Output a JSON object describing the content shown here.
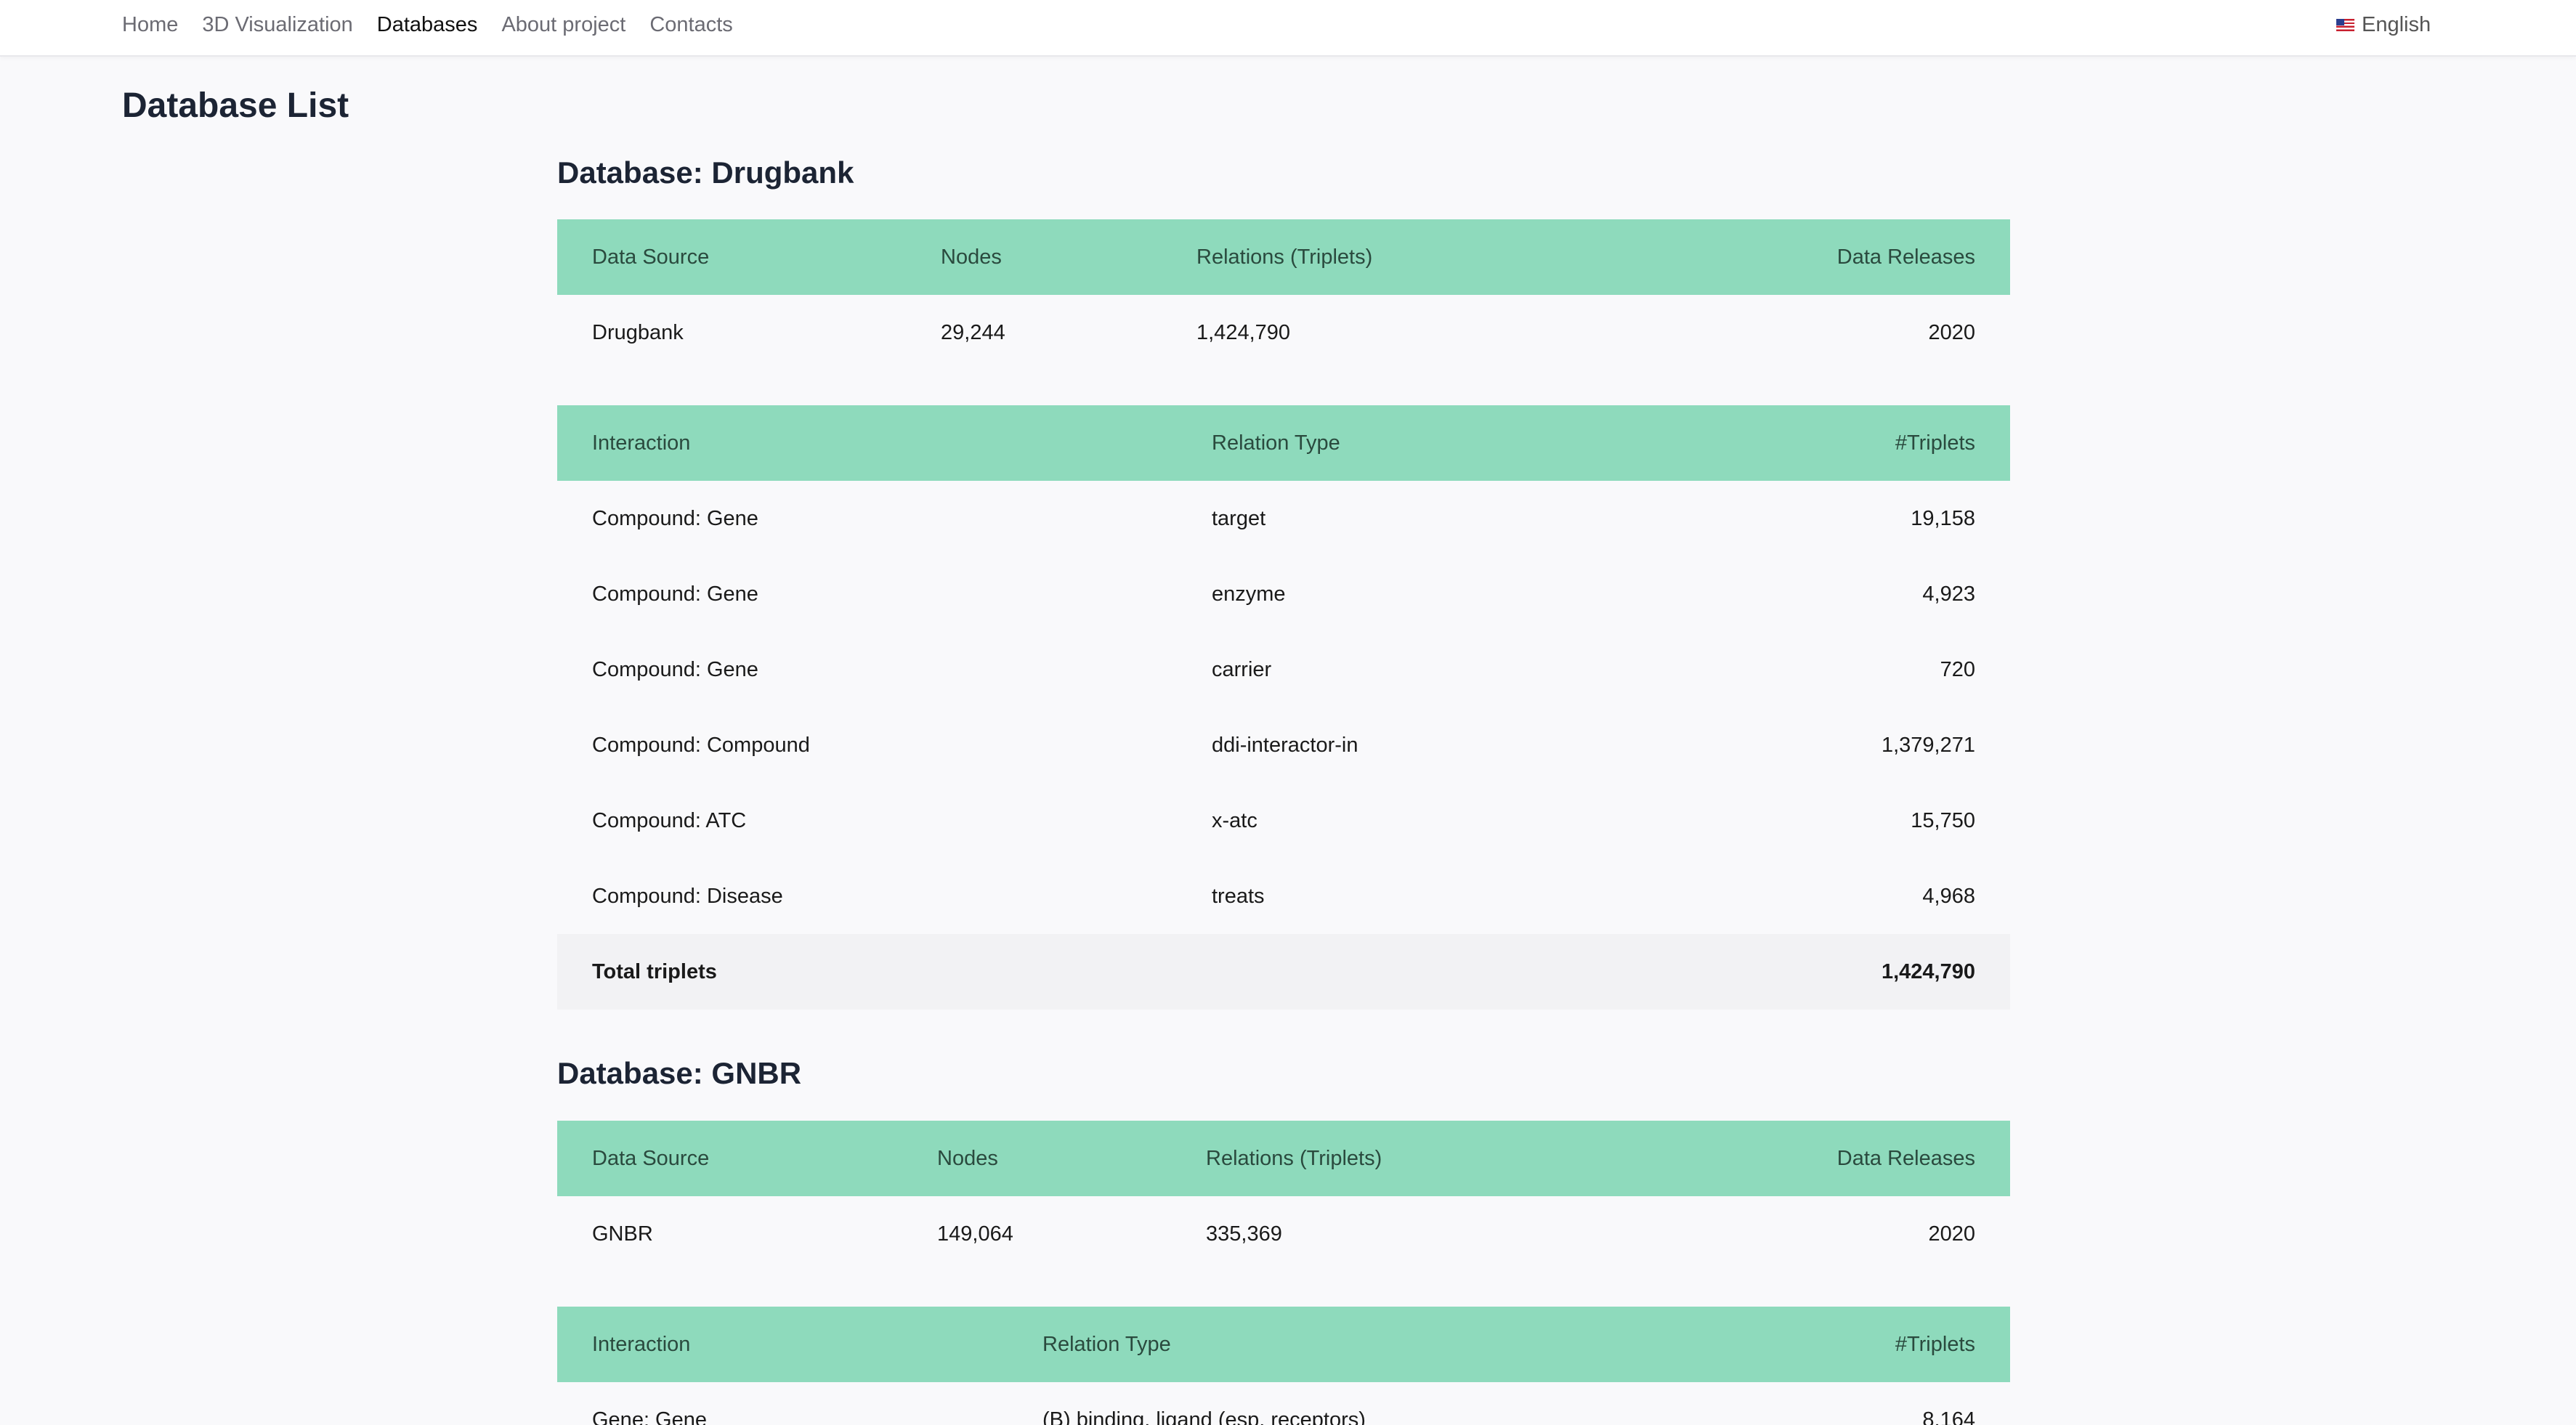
{
  "nav": {
    "links": [
      "Home",
      "3D Visualization",
      "Databases",
      "About project",
      "Contacts"
    ],
    "active": "Databases",
    "language": "English"
  },
  "page": {
    "title": "Database List"
  },
  "databases": [
    {
      "heading": "Database: Drugbank",
      "summary_headers": [
        "Data Source",
        "Nodes",
        "Relations (Triplets)",
        "Data Releases"
      ],
      "summary_row": [
        "Drugbank",
        "29,244",
        "1,424,790",
        "2020"
      ],
      "interaction_headers": [
        "Interaction",
        "Relation Type",
        "#Triplets"
      ],
      "interactions": [
        [
          "Compound: Gene",
          "target",
          "19,158"
        ],
        [
          "Compound: Gene",
          "enzyme",
          "4,923"
        ],
        [
          "Compound: Gene",
          "carrier",
          "720"
        ],
        [
          "Compound: Compound",
          "ddi-interactor-in",
          "1,379,271"
        ],
        [
          "Compound: ATC",
          "x-atc",
          "15,750"
        ],
        [
          "Compound: Disease",
          "treats",
          "4,968"
        ]
      ],
      "total_label": "Total triplets",
      "total_value": "1,424,790"
    },
    {
      "heading": "Database: GNBR",
      "summary_headers": [
        "Data Source",
        "Nodes",
        "Relations (Triplets)",
        "Data Releases"
      ],
      "summary_row": [
        "GNBR",
        "149,064",
        "335,369",
        "2020"
      ],
      "interaction_headers": [
        "Interaction",
        "Relation Type",
        "#Triplets"
      ],
      "interactions": [
        [
          "Gene: Gene",
          "(B) binding, ligand (esp. receptors)",
          "8,164"
        ]
      ]
    }
  ],
  "colors": {
    "header_bg": "#8edabc",
    "header_text": "#2a4a3e",
    "page_bg": "#f9f9fb",
    "total_row_bg": "#f2f2f4"
  },
  "icons": {
    "language": "us-flag-icon"
  }
}
